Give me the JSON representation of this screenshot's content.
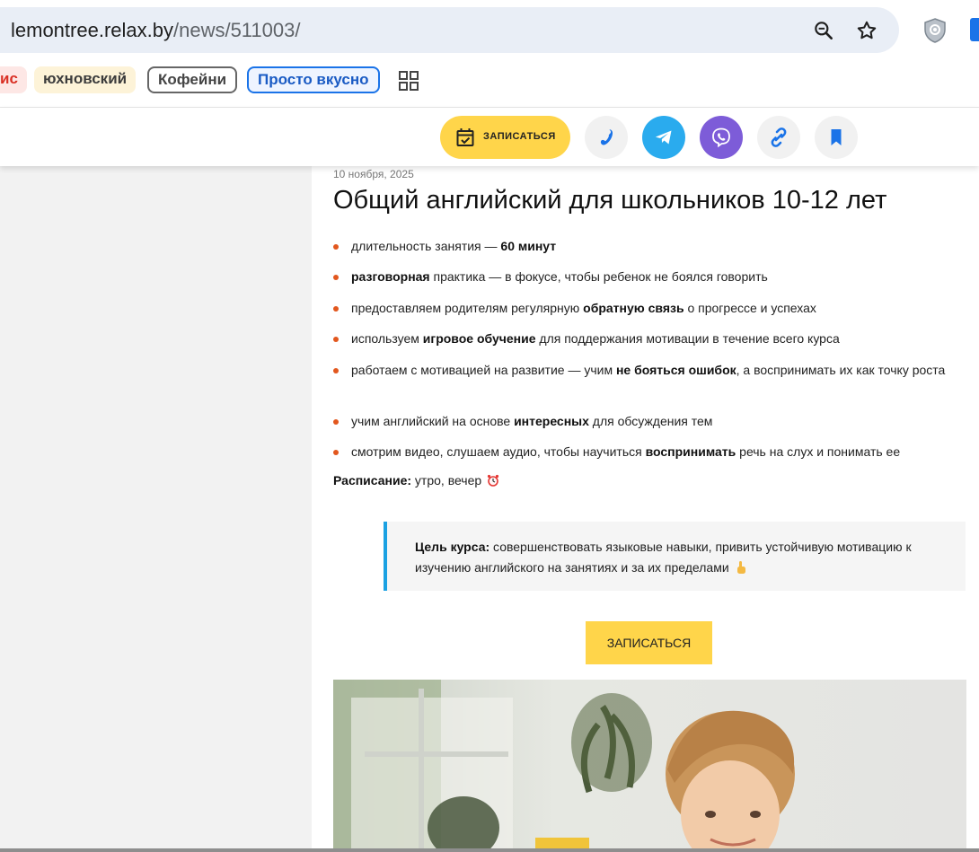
{
  "browser": {
    "url_host": "lemontree.relax.by",
    "url_path": "/news/511003/"
  },
  "chips": [
    {
      "label": "ис",
      "partial": true
    },
    {
      "label": "юхновский"
    },
    {
      "label": "Кофейни"
    },
    {
      "label": "Просто вкусно"
    }
  ],
  "header": {
    "book_label": "ЗАПИСАТЬСЯ",
    "icons": [
      "calendar-check-icon",
      "phone-icon",
      "telegram-icon",
      "viber-icon",
      "link-icon",
      "bookmark-icon"
    ],
    "colors": {
      "accent_yellow": "#ffd54a",
      "telegram": "#2aabee",
      "viber": "#7d5cd8"
    }
  },
  "article": {
    "date": "10 ноября, 2025",
    "title": "Общий английский для школьников 10-12 лет",
    "bullets": [
      {
        "before": "длительность занятия — ",
        "bold": "60 минут",
        "after": ""
      },
      {
        "before": "",
        "bold": "разговорная",
        "after": " практика — в фокусе, чтобы ребенок не боялся говорить"
      },
      {
        "before": "предоставляем родителям регулярную ",
        "bold": "обратную связь",
        "after": " о прогрессе и успехах"
      },
      {
        "before": "используем ",
        "bold": "игровое обучение",
        "after": " для поддержания мотивации в течение всего курса"
      },
      {
        "before": "работаем с мотивацией на развитие — учим ",
        "bold": "не бояться ошибок",
        "after": ", а воспринимать их как точку роста"
      },
      {
        "before": "учим английский на основе ",
        "bold": "интересных",
        "after": " для обсуждения тем"
      },
      {
        "before": "смотрим видео, слушаем аудио, чтобы научиться ",
        "bold": "воспринимать",
        "after": " речь на слух и понимать ее"
      }
    ],
    "schedule_label": "Расписание:",
    "schedule_value": " утро, вечер",
    "goal_label": "Цель курса:",
    "goal_text": " совершенствовать языковые навыки, привить устойчивую мотивацию к изучению английского на занятиях и за их пределами",
    "cta_label": "ЗАПИСАТЬСЯ",
    "bullet_color": "#e2571e",
    "quote_border_color": "#1ba1e2"
  }
}
